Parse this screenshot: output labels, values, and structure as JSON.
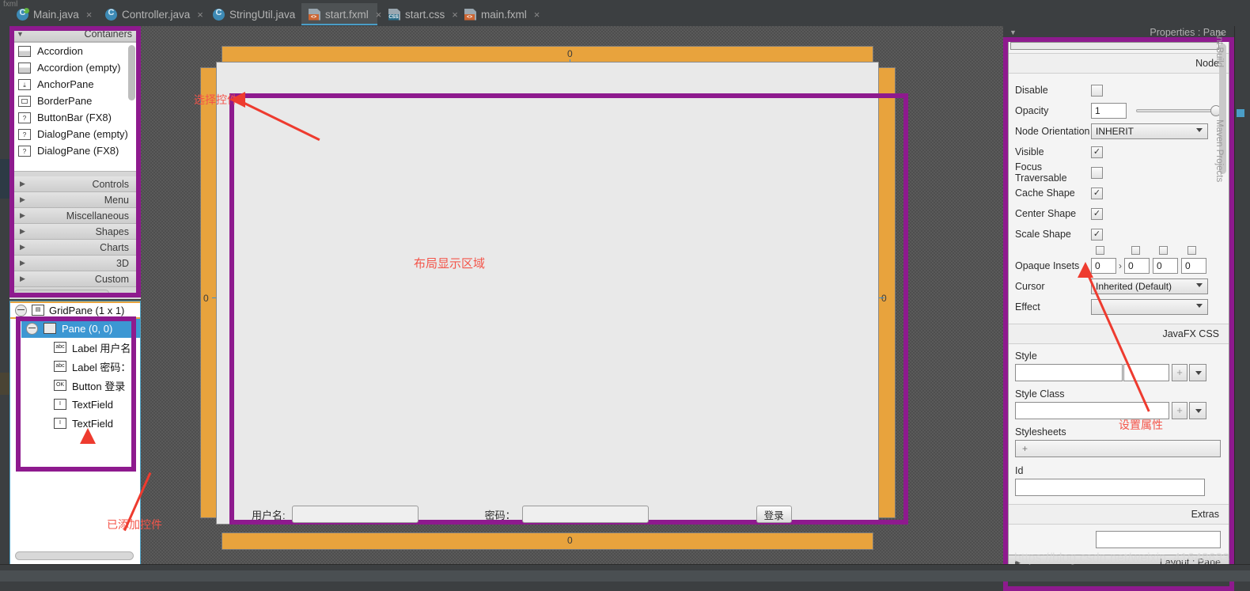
{
  "editor_tabs": [
    {
      "label": "Main.java",
      "icon": "java-class-icon",
      "selected": false,
      "close": "×"
    },
    {
      "label": "Controller.java",
      "icon": "java-class-icon",
      "selected": false,
      "close": "×"
    },
    {
      "label": "StringUtil.java",
      "icon": "java-class-icon",
      "selected": false,
      "close": "×"
    },
    {
      "label": "start.fxml",
      "icon": "fxml-file-icon",
      "badge": "<>",
      "selected": true,
      "close": "×"
    },
    {
      "label": "start.css",
      "icon": "css-file-icon",
      "badge": "CSS",
      "selected": false,
      "close": "×"
    },
    {
      "label": "main.fxml",
      "icon": "fxml-file-icon",
      "badge": "<>",
      "selected": false,
      "close": "×"
    }
  ],
  "breadcrumb": "fxml",
  "library": {
    "header": {
      "label": "Containers",
      "arrow": "▼"
    },
    "items": [
      {
        "label": "Accordion",
        "icon": "accordion-icon"
      },
      {
        "label": "Accordion  (empty)",
        "icon": "accordion-empty-icon"
      },
      {
        "label": "AnchorPane",
        "icon": "anchorpane-icon",
        "glyph": "⤓"
      },
      {
        "label": "BorderPane",
        "icon": "borderpane-icon"
      },
      {
        "label": "ButtonBar  (FX8)",
        "icon": "unknown-icon",
        "glyph": "?"
      },
      {
        "label": "DialogPane (empty)",
        "icon": "unknown-icon",
        "glyph": "?"
      },
      {
        "label": "DialogPane  (FX8)",
        "icon": "unknown-icon",
        "glyph": "?"
      }
    ],
    "sections": [
      {
        "label": "Controls",
        "arrow": "▶"
      },
      {
        "label": "Menu",
        "arrow": "▶"
      },
      {
        "label": "Miscellaneous",
        "arrow": "▶"
      },
      {
        "label": "Shapes",
        "arrow": "▶"
      },
      {
        "label": "Charts",
        "arrow": "▶"
      },
      {
        "label": "3D",
        "arrow": "▶"
      },
      {
        "label": "Custom",
        "arrow": "▶"
      }
    ]
  },
  "hierarchy": {
    "root": {
      "label": "GridPane (1 x 1)",
      "icon": "gridpane-icon",
      "toggle": "−"
    },
    "nodes": [
      {
        "label": "Pane (0, 0)",
        "icon": "pane-icon",
        "toggle": "−",
        "selected": true,
        "glyph": ""
      },
      {
        "label": "Label  用户名:",
        "icon": "label-icon",
        "glyph": "abc",
        "selected": false
      },
      {
        "label": "Label  密码：",
        "icon": "label-icon",
        "glyph": "abc",
        "selected": false
      },
      {
        "label": "Button  登录",
        "icon": "button-icon",
        "glyph": "OK",
        "selected": false
      },
      {
        "label": "TextField",
        "icon": "textfield-icon",
        "glyph": "I",
        "selected": false
      },
      {
        "label": "TextField",
        "icon": "textfield-icon",
        "glyph": "I",
        "selected": false
      }
    ]
  },
  "canvas": {
    "gutter_top_value": "0",
    "gutter_bottom_value": "0",
    "gutter_left_value": "0",
    "gutter_right_value": "0",
    "center_note": "布局显示区域",
    "form": {
      "username_label": "用户名:",
      "username_value": "",
      "password_label": "密码：",
      "password_value": "",
      "login_button": "登录"
    }
  },
  "properties": {
    "title": "Properties : Pane",
    "title_arrow": "▼",
    "group_node": "Node",
    "group_javafx_css": "JavaFX CSS",
    "group_extras": "Extras",
    "rows": [
      {
        "key": "Disable",
        "type": "checkbox",
        "checked": false
      },
      {
        "key": "Opacity",
        "type": "number-slider",
        "value": "1"
      },
      {
        "key": "Node Orientation",
        "type": "combo",
        "value": "INHERIT"
      },
      {
        "key": "Visible",
        "type": "checkbox",
        "checked": true
      },
      {
        "key": "Focus Traversable",
        "type": "checkbox",
        "checked": false
      },
      {
        "key": "Cache Shape",
        "type": "checkbox",
        "checked": true
      },
      {
        "key": "Center Shape",
        "type": "checkbox",
        "checked": true
      },
      {
        "key": "Scale Shape",
        "type": "checkbox",
        "checked": true
      }
    ],
    "opaque_insets": {
      "key": "Opaque Insets",
      "values": [
        "0",
        "0",
        "0",
        "0"
      ],
      "link_glyph": "›"
    },
    "cursor": {
      "key": "Cursor",
      "value": "Inherited (Default)"
    },
    "effect": {
      "key": "Effect",
      "value": ""
    },
    "style": {
      "key": "Style",
      "value": "",
      "value2": "",
      "plus": "+"
    },
    "style_class": {
      "key": "Style Class",
      "value": "",
      "plus": "+"
    },
    "stylesheets": {
      "key": "Stylesheets",
      "plus": "+"
    },
    "id": {
      "key": "Id",
      "value": ""
    },
    "layout_bar": {
      "label": "Layout : Pane",
      "arrow": "▶"
    }
  },
  "right_tool_tabs": [
    "Ant Build",
    "Maven Projects"
  ],
  "annotations": [
    {
      "id": "select-control",
      "text": "选择控件"
    },
    {
      "id": "added-controls",
      "text": "已添加控件"
    },
    {
      "id": "set-properties",
      "text": "设置属性"
    }
  ],
  "watermark": "https://blog.csdn.net/weixin_41648633",
  "colors": {
    "accent_purple": "#8e1a8e",
    "annotation_red": "#f4554a",
    "gutter_orange": "#e8a33d",
    "selection_blue": "#3c97d3",
    "ide_dark": "#3c3f41"
  }
}
